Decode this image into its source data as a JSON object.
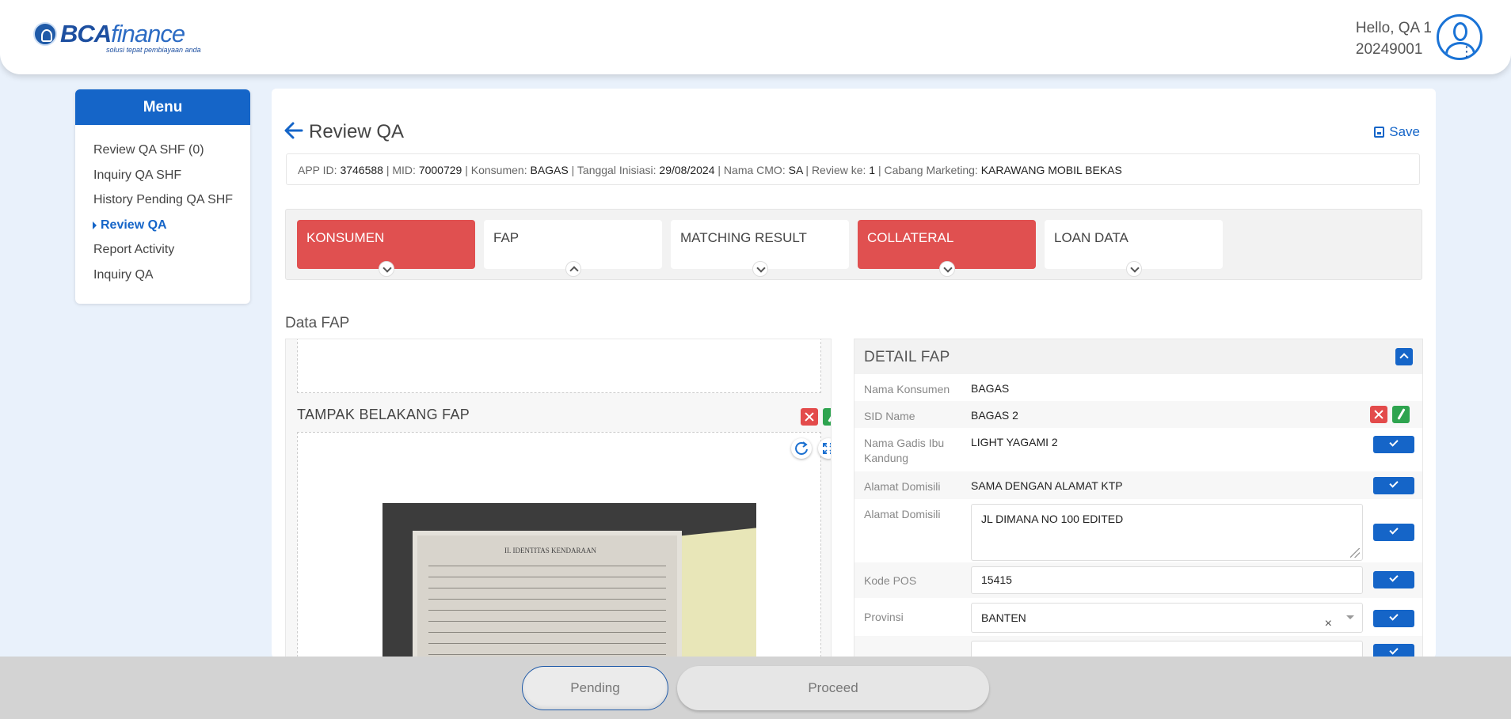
{
  "brand": {
    "name_bold": "BCA",
    "name_thin": "finance",
    "tagline": "solusi tepat pembiayaan anda"
  },
  "user": {
    "greeting": "Hello, QA 1",
    "id": "20249001"
  },
  "menu": {
    "title": "Menu",
    "items": [
      {
        "label": "Review QA SHF (0)"
      },
      {
        "label": "Inquiry QA SHF"
      },
      {
        "label": "History Pending QA SHF"
      },
      {
        "label": "Review QA",
        "active": true
      },
      {
        "label": "Report Activity"
      },
      {
        "label": "Inquiry QA"
      }
    ]
  },
  "page": {
    "title": "Review QA",
    "save_label": "Save"
  },
  "info": {
    "app_id_label": "APP ID:",
    "app_id": "3746588",
    "mid_label": "MID:",
    "mid": "7000729",
    "konsumen_label": "Konsumen:",
    "konsumen": "BAGAS",
    "tanggal_label": "Tanggal Inisiasi:",
    "tanggal": "29/08/2024",
    "cmo_label": "Nama CMO:",
    "cmo": "SA",
    "review_label": "Review ke:",
    "review": "1",
    "cabang_label": "Cabang Marketing:",
    "cabang": "KARAWANG MOBIL BEKAS",
    "separator": "|"
  },
  "tabs": [
    {
      "label": "KONSUMEN",
      "status": "error",
      "chevron": "down"
    },
    {
      "label": "FAP",
      "status": "normal",
      "chevron": "up"
    },
    {
      "label": "MATCHING RESULT",
      "status": "normal",
      "chevron": "down"
    },
    {
      "label": "COLLATERAL",
      "status": "error",
      "chevron": "down"
    },
    {
      "label": "LOAN DATA",
      "status": "normal",
      "chevron": "down"
    }
  ],
  "section": {
    "title": "Data FAP"
  },
  "left_panel": {
    "belakang_title": "TAMPAK BELAKANG FAP",
    "doc_heading": "II. IDENTITAS KENDARAAN"
  },
  "detail": {
    "title": "DETAIL FAP",
    "rows": {
      "nama_konsumen": {
        "label": "Nama Konsumen",
        "value": "BAGAS"
      },
      "sid_name": {
        "label": "SID Name",
        "value": "BAGAS 2"
      },
      "nama_gadis": {
        "label": "Nama Gadis Ibu Kandung",
        "value": "LIGHT YAGAMI 2"
      },
      "alamat_domisili_1": {
        "label": "Alamat Domisili",
        "value": "SAMA DENGAN ALAMAT KTP"
      },
      "alamat_domisili_2": {
        "label": "Alamat Domisili",
        "value": "JL DIMANA NO 100 EDITED"
      },
      "kode_pos": {
        "label": "Kode POS",
        "value": "15415"
      },
      "provinsi": {
        "label": "Provinsi",
        "value": "BANTEN"
      }
    }
  },
  "footer": {
    "pending_label": "Pending",
    "proceed_label": "Proceed"
  },
  "colors": {
    "primary": "#1565c8",
    "error_tab": "#e05050",
    "delete": "#e34b4b",
    "edit": "#2ea44f"
  }
}
